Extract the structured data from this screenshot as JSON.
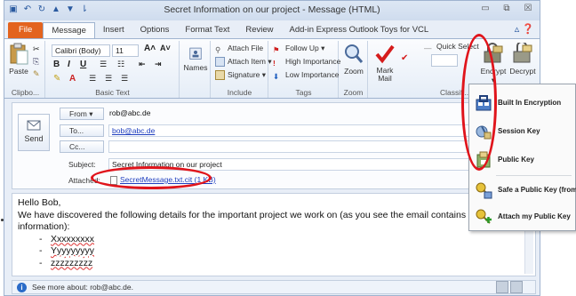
{
  "window": {
    "title": "Secret Information on our project - Message (HTML)",
    "minimize": "▭",
    "restore": "⧉",
    "close": "☒"
  },
  "tabs": [
    {
      "label": "File"
    },
    {
      "label": "Message"
    },
    {
      "label": "Insert"
    },
    {
      "label": "Options"
    },
    {
      "label": "Format Text"
    },
    {
      "label": "Review"
    },
    {
      "label": "Add-in Express Outlook Toys for VCL"
    }
  ],
  "ribbon": {
    "clipboard": {
      "paste": "Paste",
      "label": "Clipbo..."
    },
    "basic_text": {
      "font": "Calibri (Body)",
      "size": "11",
      "label": "Basic Text"
    },
    "names": {
      "label": "Names"
    },
    "include": {
      "attach_file": "Attach File",
      "attach_item": "Attach Item",
      "signature": "Signature",
      "label": "Include"
    },
    "tags": {
      "follow_up": "Follow Up",
      "high_importance": "High Importance",
      "low_importance": "Low Importance",
      "label": "Tags"
    },
    "zoom": {
      "button": "Zoom",
      "label": "Zoom"
    },
    "classify": {
      "mark_mail": "Mark Mail",
      "quick_select": "Quick Select",
      "encrypt": "Encrypt",
      "decrypt": "Decrypt",
      "label": "Classifi..."
    }
  },
  "compose": {
    "send": "Send",
    "from_button": "From",
    "from_value": "rob@abc.de",
    "to_button": "To...",
    "to_value": "bob@abc.de",
    "cc_button": "Cc...",
    "cc_value": "",
    "subject_label": "Subject:",
    "subject_value": "Secret Information on our project",
    "attached_label": "Attached:",
    "attachment": "SecretMessage.txt.cit (1 KB)"
  },
  "body": {
    "greeting": "Hello Bob,",
    "line1": "We have discovered the following details for the important project we work on (as you see the email contains very se",
    "line2": "information):",
    "items": [
      "Xxxxxxxxx",
      "Yyyyyyyyy",
      "zzzzzzzzz"
    ]
  },
  "infobar": {
    "text": "See more about: rob@abc.de."
  },
  "encrypt_menu": [
    {
      "label": "Built In Encryption",
      "icon": "built-in-encryption-icon"
    },
    {
      "label": "Session Key",
      "icon": "session-key-icon"
    },
    {
      "label": "Public Key",
      "icon": "public-key-icon"
    },
    {
      "label": "Safe a Public Key (from",
      "icon": "save-public-key-icon"
    },
    {
      "label": "Attach my Public Key",
      "icon": "attach-public-key-icon"
    }
  ],
  "colors": {
    "highlight_red": "#e0141b",
    "file_tab": "#e3631e",
    "link_blue": "#1f3fbf"
  }
}
